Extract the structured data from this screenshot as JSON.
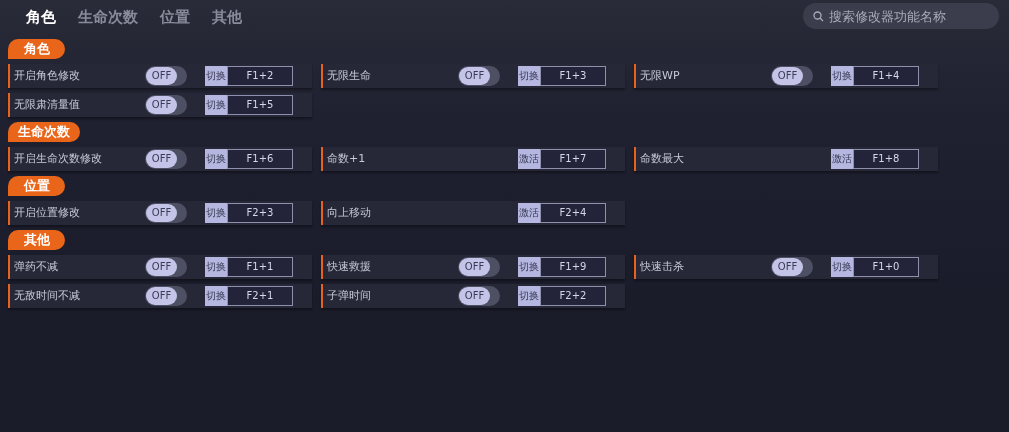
{
  "tabs": [
    {
      "label": "角色",
      "selected": true
    },
    {
      "label": "生命次数",
      "selected": false
    },
    {
      "label": "位置",
      "selected": false
    },
    {
      "label": "其他",
      "selected": false
    }
  ],
  "search": {
    "placeholder": "搜索修改器功能名称"
  },
  "sections": [
    {
      "title": "角色",
      "items": [
        {
          "label": "开启角色修改",
          "kind": "toggle",
          "on": false,
          "switch_text": "OFF",
          "action": "切换",
          "hotkey": "F1+2"
        },
        {
          "label": "无限生命",
          "kind": "toggle",
          "on": false,
          "switch_text": "OFF",
          "action": "切换",
          "hotkey": "F1+3"
        },
        {
          "label": "无限WP",
          "kind": "toggle",
          "on": false,
          "switch_text": "OFF",
          "action": "切换",
          "hotkey": "F1+4"
        },
        {
          "label": "无限肃清量值",
          "kind": "toggle",
          "on": false,
          "switch_text": "OFF",
          "action": "切换",
          "hotkey": "F1+5"
        }
      ]
    },
    {
      "title": "生命次数",
      "items": [
        {
          "label": "开启生命次数修改",
          "kind": "toggle",
          "on": false,
          "switch_text": "OFF",
          "action": "切换",
          "hotkey": "F1+6"
        },
        {
          "label": "命数+1",
          "kind": "button",
          "action": "激活",
          "hotkey": "F1+7"
        },
        {
          "label": "命数最大",
          "kind": "button",
          "action": "激活",
          "hotkey": "F1+8"
        }
      ]
    },
    {
      "title": "位置",
      "items": [
        {
          "label": "开启位置修改",
          "kind": "toggle",
          "on": false,
          "switch_text": "OFF",
          "action": "切换",
          "hotkey": "F2+3"
        },
        {
          "label": "向上移动",
          "kind": "button",
          "action": "激活",
          "hotkey": "F2+4"
        }
      ]
    },
    {
      "title": "其他",
      "items": [
        {
          "label": "弹药不减",
          "kind": "toggle",
          "on": false,
          "switch_text": "OFF",
          "action": "切换",
          "hotkey": "F1+1"
        },
        {
          "label": "快速救援",
          "kind": "toggle",
          "on": false,
          "switch_text": "OFF",
          "action": "切换",
          "hotkey": "F1+9"
        },
        {
          "label": "快速击杀",
          "kind": "toggle",
          "on": false,
          "switch_text": "OFF",
          "action": "切换",
          "hotkey": "F1+0"
        },
        {
          "label": "无敌时间不减",
          "kind": "toggle",
          "on": false,
          "switch_text": "OFF",
          "action": "切换",
          "hotkey": "F2+1"
        },
        {
          "label": "子弹时间",
          "kind": "toggle",
          "on": false,
          "switch_text": "OFF",
          "action": "切换",
          "hotkey": "F2+2"
        }
      ]
    }
  ]
}
